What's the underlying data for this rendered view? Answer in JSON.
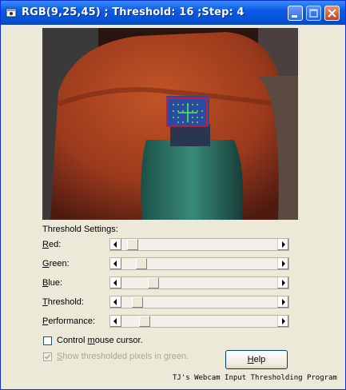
{
  "window": {
    "title": "RGB(9,25,45) ; Threshold: 16 ;Step: 4",
    "icon": "webcam-app-icon",
    "controls": [
      "minimize-icon",
      "maximize-icon",
      "close-icon"
    ]
  },
  "colors": {
    "titlebar": "#0552d6",
    "detection_box": "#e01818",
    "detection_marks": "#44ff44"
  },
  "settings": {
    "heading": "Threshold Settings:",
    "sliders": [
      {
        "label": "Red:",
        "accel": "R",
        "rest": "ed:",
        "value": 0.04
      },
      {
        "label": "Green:",
        "accel": "G",
        "rest": "reen:",
        "value": 0.1
      },
      {
        "label": "Blue:",
        "accel": "B",
        "rest": "lue:",
        "value": 0.18
      },
      {
        "label": "Threshold:",
        "accel": "T",
        "rest": "hreshold:",
        "value": 0.07
      },
      {
        "label": "Performance:",
        "accel": "P",
        "rest": "erformance:",
        "value": 0.12
      }
    ]
  },
  "options": {
    "control_mouse": {
      "pre": "Control ",
      "accel": "m",
      "post": "ouse cursor.",
      "checked": false
    },
    "show_thresholded": {
      "pre": "",
      "accel": "S",
      "post": "how thresholded pixels in green.",
      "checked": true,
      "disabled": true
    }
  },
  "help_button": {
    "accel": "H",
    "rest": "elp"
  },
  "footer": "TJ's Webcam Input Thresholding Program"
}
